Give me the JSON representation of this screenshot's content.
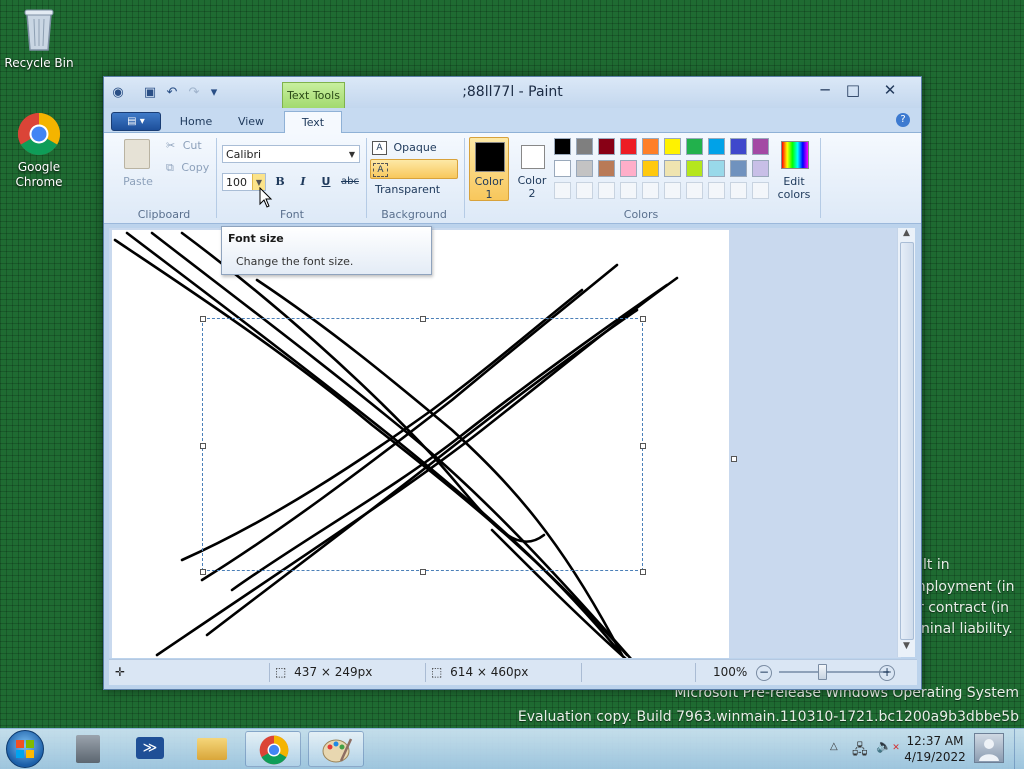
{
  "desktop": {
    "icons": [
      {
        "label": "Recycle Bin",
        "icon": "recycle-bin-icon"
      },
      {
        "label": "Google Chrome",
        "icon": "chrome-icon"
      }
    ],
    "watermark": {
      "line1": "Microsoft Pre-release Windows Operating System",
      "line2": "Evaluation copy. Build 7963.winmain.110310-1721.bc1200a9b3dbbe5b"
    },
    "background_text": [
      "lt in",
      "mployment (in",
      "r contract (in",
      "ninal liability."
    ]
  },
  "window": {
    "title": ";88ll77l - Paint",
    "contextual_tab": "Text Tools",
    "tabs": [
      {
        "label": "Home",
        "active": false
      },
      {
        "label": "View",
        "active": false
      },
      {
        "label": "Text",
        "active": true
      }
    ],
    "controls": {
      "minimize": "─",
      "maximize": "□",
      "close": "✕"
    },
    "help": "?"
  },
  "ribbon": {
    "clipboard": {
      "paste": "Paste",
      "cut": "Cut",
      "copy": "Copy",
      "group_label": "Clipboard"
    },
    "font": {
      "family": "Calibri",
      "size": "100",
      "bold": "B",
      "italic": "I",
      "underline": "U",
      "strikethrough": "abc",
      "group_label": "Font"
    },
    "background": {
      "opaque": "Opaque",
      "transparent": "Transparent",
      "selected": "Transparent",
      "group_label": "Background"
    },
    "colors": {
      "color1_label_1": "Color",
      "color1_label_2": "1",
      "color2_label_1": "Color",
      "color2_label_2": "2",
      "color1": "#000000",
      "color2": "#ffffff",
      "palette_row1": [
        "#000000",
        "#7f7f7f",
        "#880015",
        "#ed1c24",
        "#ff7f27",
        "#fff200",
        "#22b14c",
        "#00a2e8",
        "#3f48cc",
        "#a349a4"
      ],
      "palette_row2": [
        "#ffffff",
        "#c3c3c3",
        "#b97a57",
        "#ffaec9",
        "#ffc90e",
        "#efe4b0",
        "#b5e61d",
        "#99d9ea",
        "#7092be",
        "#c8bfe7"
      ],
      "edit_colors_1": "Edit",
      "edit_colors_2": "colors",
      "group_label": "Colors"
    }
  },
  "tooltip": {
    "title": "Font size",
    "body": "Change the font size."
  },
  "status": {
    "selection_size": "437 × 249px",
    "image_size": "614 × 460px",
    "zoom": "100%"
  },
  "taskbar": {
    "items": [
      "start-orb",
      "server-manager-icon",
      "powershell-icon",
      "explorer-icon",
      "chrome-icon",
      "paint-icon"
    ],
    "time": "12:37 AM",
    "date": "4/19/2022"
  }
}
